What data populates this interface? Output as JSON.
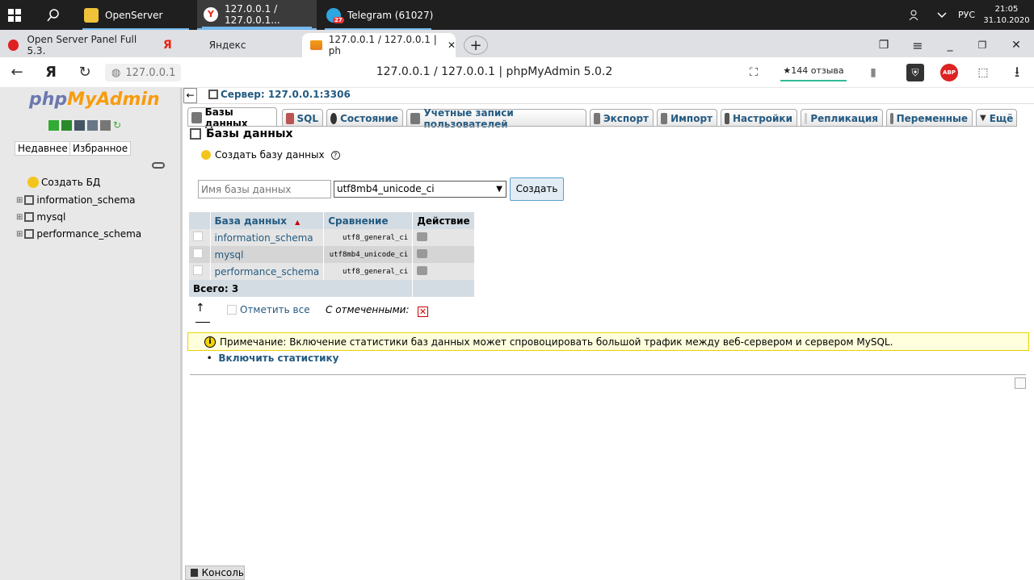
{
  "taskbar": {
    "apps": [
      {
        "label": "OpenServer"
      },
      {
        "label": "127.0.0.1 / 127.0.0.1..."
      },
      {
        "label": "Telegram (61027)",
        "badge": "27"
      }
    ],
    "language": "РУС",
    "time": "21:05",
    "date": "31.10.2020"
  },
  "browser": {
    "tabs": [
      {
        "label": "Open Server Panel Full 5.3."
      },
      {
        "label": "Яндекс"
      },
      {
        "label": "127.0.0.1 / 127.0.0.1 | ph"
      }
    ],
    "address": "127.0.0.1",
    "page_title": "127.0.0.1 / 127.0.0.1 | phpMyAdmin 5.0.2",
    "reviews": "★144 отзыва",
    "abp": "ABP"
  },
  "sidebar": {
    "logo_php": "php",
    "logo_myadmin": "MyAdmin",
    "recent_label": "Недавнее",
    "favorites_label": "Избранное",
    "tree": [
      {
        "label": "Создать БД"
      },
      {
        "label": "information_schema"
      },
      {
        "label": "mysql"
      },
      {
        "label": "performance_schema"
      }
    ]
  },
  "main": {
    "server_label": "Сервер: 127.0.0.1:3306",
    "tabs": [
      {
        "label": "Базы данных"
      },
      {
        "label": "SQL"
      },
      {
        "label": "Состояние"
      },
      {
        "label": "Учетные записи пользователей"
      },
      {
        "label": "Экспорт"
      },
      {
        "label": "Импорт"
      },
      {
        "label": "Настройки"
      },
      {
        "label": "Репликация"
      },
      {
        "label": "Переменные"
      },
      {
        "label": "Ещё"
      }
    ],
    "heading": "Базы данных",
    "create_heading": "Создать базу данных",
    "db_name_placeholder": "Имя базы данных",
    "collation_selected": "utf8mb4_unicode_ci",
    "create_button": "Создать",
    "table": {
      "headers": [
        "База данных",
        "Сравнение",
        "Действие"
      ],
      "rows": [
        {
          "name": "information_schema",
          "collation": "utf8_general_ci"
        },
        {
          "name": "mysql",
          "collation": "utf8mb4_unicode_ci"
        },
        {
          "name": "performance_schema",
          "collation": "utf8_general_ci"
        }
      ],
      "total": "Всего: 3"
    },
    "check_all": "Отметить все",
    "with_selected": "С отмеченными:",
    "notice": "Примечание: Включение статистики баз данных может спровоцировать большой трафик между веб-сервером и сервером MySQL.",
    "enable_stats": "Включить статистику",
    "console": "Консоль"
  }
}
